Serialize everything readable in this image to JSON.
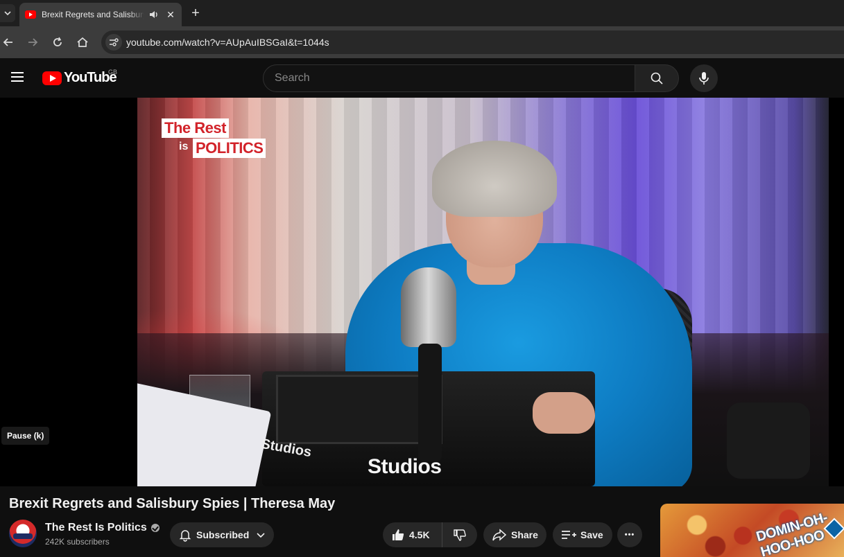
{
  "browser": {
    "tab_title": "Brexit Regrets and Salisbury Spies | Theresa May",
    "tab_close": "✕",
    "new_tab": "+",
    "url": "youtube.com/watch?v=AUpAuIBSGaI&t=1044s"
  },
  "masthead": {
    "logo_text": "YouTube",
    "country_code": "GB",
    "search_placeholder": "Search"
  },
  "video": {
    "overlay_brand_line1": "The Rest",
    "overlay_brand_is": "is",
    "overlay_brand_line2": "POLITICS",
    "studio_sign": "Studios",
    "studio_sign_small": "Studios",
    "tooltip": "Pause (k)",
    "title": "Brexit Regrets and Salisbury Spies | Theresa May"
  },
  "channel": {
    "name": "The Rest Is Politics",
    "subscribers": "242K subscribers",
    "subscribe_label": "Subscribed"
  },
  "actions": {
    "likes": "4.5K",
    "share_label": "Share",
    "save_label": "Save",
    "more_label": "•••"
  },
  "ad": {
    "text": "DOMIN-OH-HOO-HOO"
  },
  "colors": {
    "yt_red": "#ff0000",
    "background": "#0f0f0f",
    "pill": "#272727"
  }
}
